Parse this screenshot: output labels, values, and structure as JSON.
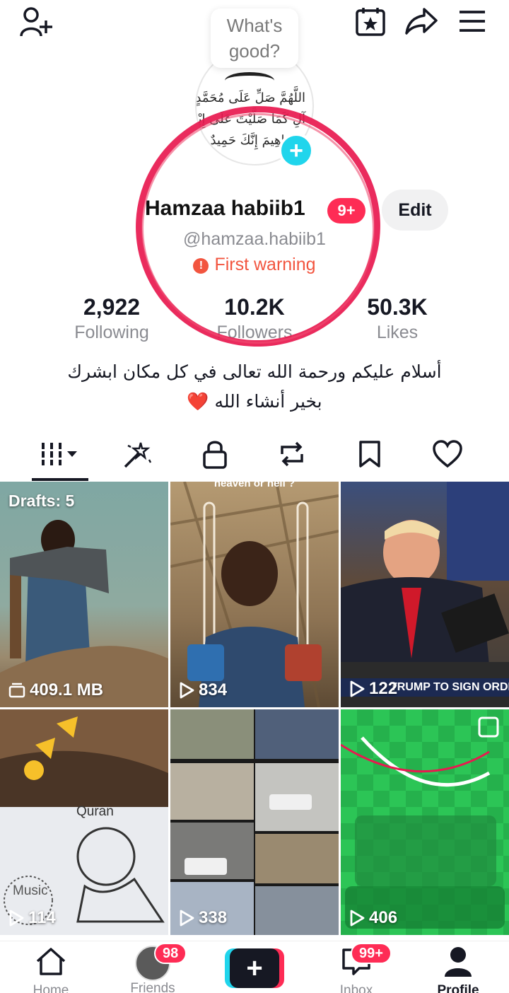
{
  "header": {
    "status_bubble_line1": "What's",
    "status_bubble_line2": "good?",
    "add_friend_icon": "person-add-icon",
    "calendar_icon": "calendar-star-icon",
    "share_icon": "share-arrow-icon",
    "menu_icon": "hamburger-menu-icon"
  },
  "profile": {
    "avatar_text_line1": "اللَّهُمَّ صَلِّ عَلَى مُحَمَّدٍ وَعَلَى",
    "avatar_text_line2": "آلِ كَمَا صَلَّيْتَ عَلَى إِبْرَاهِيمَ",
    "avatar_text_line3": "إِبْرَاهِيمَ إِنَّكَ حَمِيدٌ",
    "add_badge": "+",
    "name": "Hamzaa habiib1",
    "notification_badge": "9+",
    "edit_label": "Edit",
    "handle": "@hamzaa.habiib1",
    "warning": "First warning",
    "warning_icon": "!"
  },
  "stats": [
    {
      "value": "2,922",
      "label": "Following"
    },
    {
      "value": "10.2K",
      "label": "Followers"
    },
    {
      "value": "50.3K",
      "label": "Likes"
    }
  ],
  "bio": {
    "line1": "أسلام عليكم ورحمة الله تعالى في كل مكان ابشرك",
    "line2": "بخير أنشاء الله",
    "heart": "❤️"
  },
  "tabs": [
    "videos-grid-icon",
    "magic-wand-icon",
    "lock-icon",
    "repost-icon",
    "bookmark-icon",
    "heart-icon"
  ],
  "videos": [
    {
      "overlay": "Drafts: 5",
      "meta": "409.1 MB",
      "kind": "drafts"
    },
    {
      "headline": "heaven or hell ?",
      "meta": "834"
    },
    {
      "banner": "TRUMP TO SIGN ORDER ON",
      "meta": "122"
    },
    {
      "label": "Quran",
      "label2": "Music",
      "meta": "114"
    },
    {
      "meta": "338"
    },
    {
      "meta": "406"
    }
  ],
  "bottom_nav": {
    "home": "Home",
    "friends": "Friends",
    "friends_badge": "98",
    "create": "+",
    "inbox": "Inbox",
    "inbox_badge": "99+",
    "profile": "Profile"
  },
  "colors": {
    "accent_red": "#fe2c55",
    "accent_cyan": "#20d5ec",
    "warning": "#f2553f",
    "annotation_circle": "#e8194f"
  }
}
